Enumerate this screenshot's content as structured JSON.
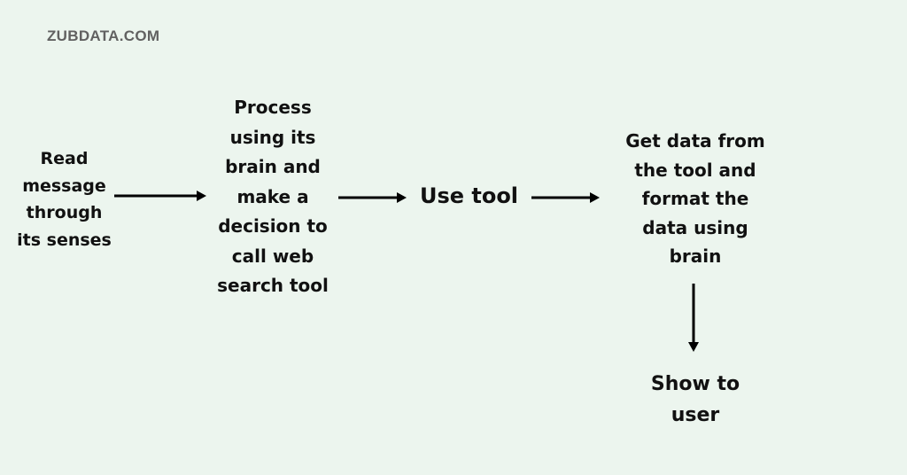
{
  "brand": "ZUBDATA.COM",
  "flow": {
    "nodes": [
      {
        "id": "read",
        "label": "Read\nmessage\nthrough\nits senses"
      },
      {
        "id": "process",
        "label": "Process\nusing its\nbrain and\nmake a\ndecision to\ncall web\nsearch tool"
      },
      {
        "id": "use-tool",
        "label": "Use tool"
      },
      {
        "id": "get-data",
        "label": "Get data from\nthe tool and\nformat the\ndata using\nbrain"
      },
      {
        "id": "show",
        "label": "Show to\nuser"
      }
    ],
    "edges": [
      {
        "from": "read",
        "to": "process",
        "direction": "right"
      },
      {
        "from": "process",
        "to": "use-tool",
        "direction": "right"
      },
      {
        "from": "use-tool",
        "to": "get-data",
        "direction": "right"
      },
      {
        "from": "get-data",
        "to": "show",
        "direction": "down"
      }
    ]
  },
  "colors": {
    "background": "#ecf5ee",
    "text": "#111111",
    "brand": "#616161",
    "arrow": "#000000"
  }
}
